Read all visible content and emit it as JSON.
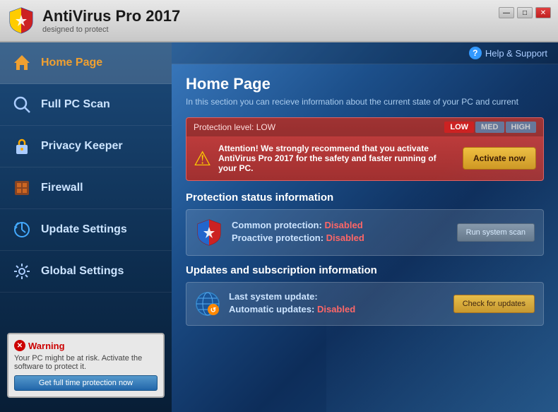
{
  "titlebar": {
    "title": "AntiVirus Pro 2017",
    "subtitle": "designed to protect",
    "controls": {
      "minimize": "—",
      "maximize": "□",
      "close": "✕"
    }
  },
  "help": {
    "label": "Help & Support"
  },
  "sidebar": {
    "items": [
      {
        "id": "home",
        "label": "Home Page",
        "active": true
      },
      {
        "id": "fullscan",
        "label": "Full PC Scan",
        "active": false
      },
      {
        "id": "privacy",
        "label": "Privacy Keeper",
        "active": false
      },
      {
        "id": "firewall",
        "label": "Firewall",
        "active": false
      },
      {
        "id": "update",
        "label": "Update Settings",
        "active": false
      },
      {
        "id": "global",
        "label": "Global Settings",
        "active": false
      }
    ],
    "warning": {
      "title": "Warning",
      "text": "Your PC might be at risk. Activate the software to protect it.",
      "button": "Get full time protection now"
    }
  },
  "content": {
    "page_title": "Home Page",
    "page_desc": "In this section you can recieve information about the current state of your PC and current",
    "protection": {
      "level_label": "Protection level: LOW",
      "levels": [
        "LOW",
        "MED",
        "HIGH"
      ],
      "message": "Attention! We strongly recommend that you activate AntiVirus Pro 2017 for the safety and faster running of your PC.",
      "activate_btn": "Activate now"
    },
    "status_section": {
      "title": "Protection status information",
      "common_label": "Common protection:",
      "common_value": "Disabled",
      "proactive_label": "Proactive protection:",
      "proactive_value": "Disabled",
      "scan_btn": "Run system scan"
    },
    "updates_section": {
      "title": "Updates and subscription information",
      "last_update_label": "Last system update:",
      "last_update_value": "",
      "auto_label": "Automatic updates:",
      "auto_value": "Disabled",
      "check_btn": "Check for updates"
    }
  }
}
